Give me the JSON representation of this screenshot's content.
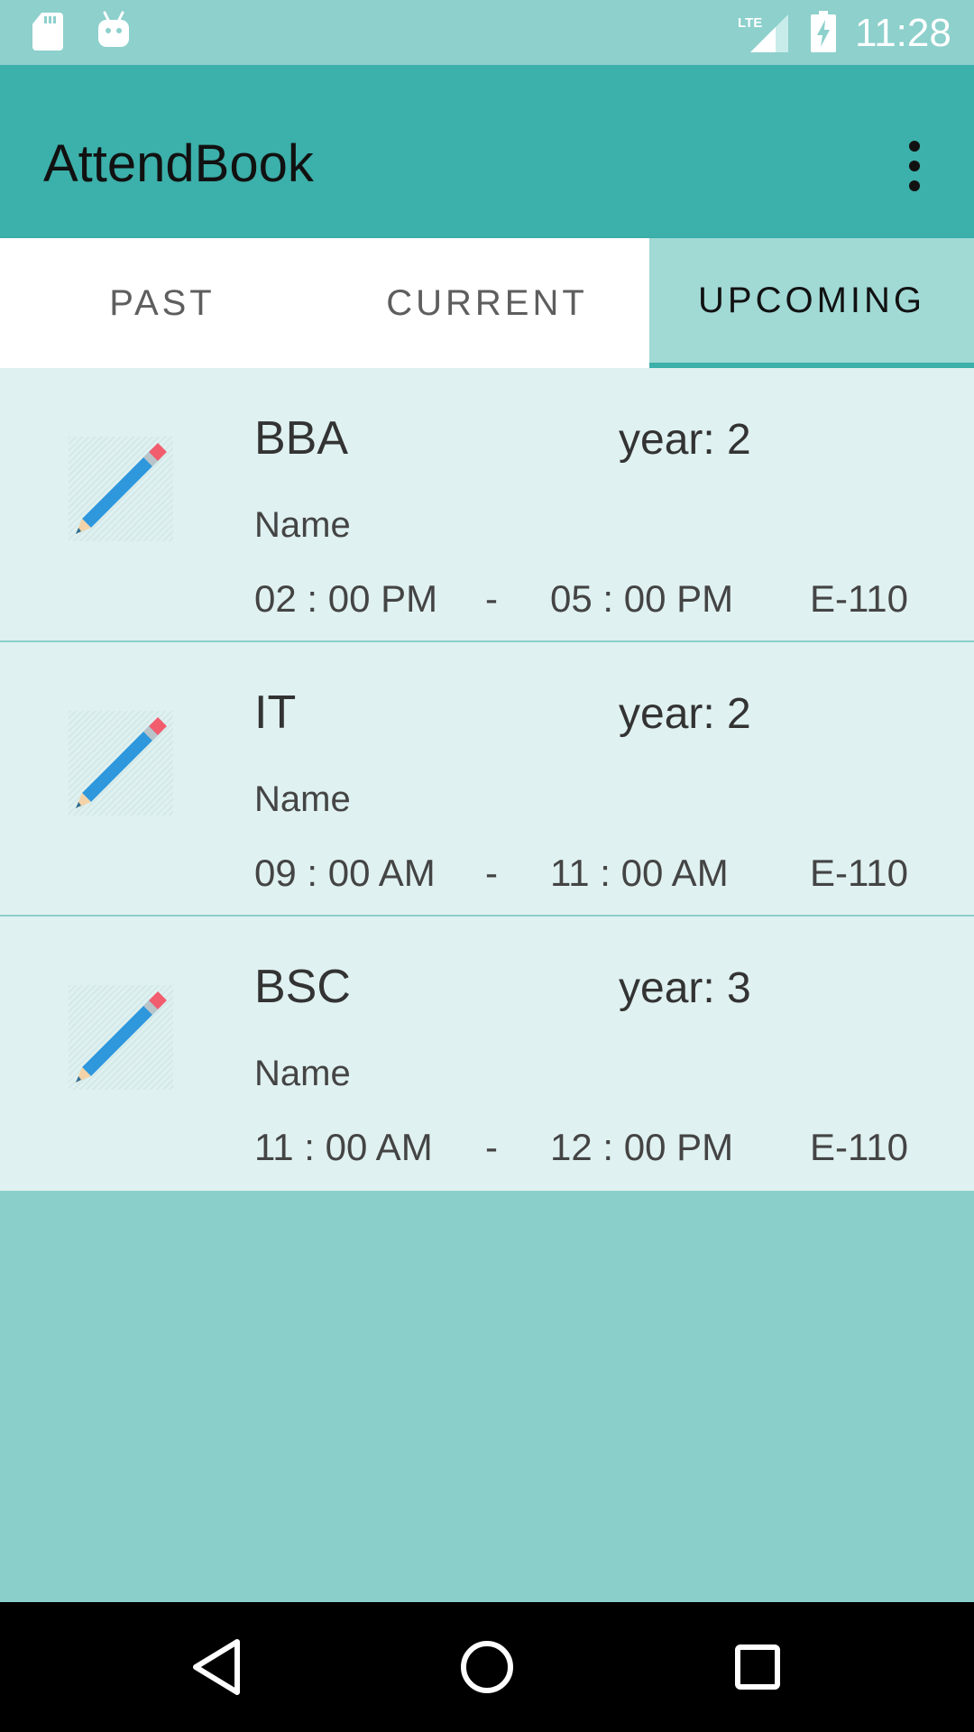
{
  "status_bar": {
    "time": "11:28",
    "network": "LTE",
    "icons": [
      "sd-card-icon",
      "android-debug-icon",
      "lte-signal-icon",
      "battery-charging-icon"
    ]
  },
  "app_bar": {
    "title": "AttendBook",
    "overflow_icon": "more-vert-icon"
  },
  "tabs": [
    {
      "label": "PAST",
      "selected": false
    },
    {
      "label": "CURRENT",
      "selected": false
    },
    {
      "label": "UPCOMING",
      "selected": true
    }
  ],
  "sessions": [
    {
      "subject": "BBA",
      "year": "year: 2",
      "name": "Name",
      "start": "02 : 00 PM",
      "separator": "-",
      "end": "05 : 00 PM",
      "room": "E-110",
      "icon": "pencil-icon"
    },
    {
      "subject": "IT",
      "year": "year: 2",
      "name": "Name",
      "start": "09 : 00 AM",
      "separator": "-",
      "end": "11 : 00 AM",
      "room": "E-110",
      "icon": "pencil-icon"
    },
    {
      "subject": "BSC",
      "year": "year: 3",
      "name": "Name",
      "start": "11 : 00 AM",
      "separator": "-",
      "end": "12 : 00 PM",
      "room": "E-110",
      "icon": "pencil-icon"
    }
  ],
  "nav_bar": {
    "icons": [
      "back-icon",
      "home-icon",
      "recents-icon"
    ]
  },
  "colors": {
    "app_bar": "#3cb0aa",
    "status_bar": "#8dd0cc",
    "tab_selected_bg": "#a1d9d5",
    "row_bg": "#dff1f0",
    "page_bg": "#8bcfcb"
  }
}
